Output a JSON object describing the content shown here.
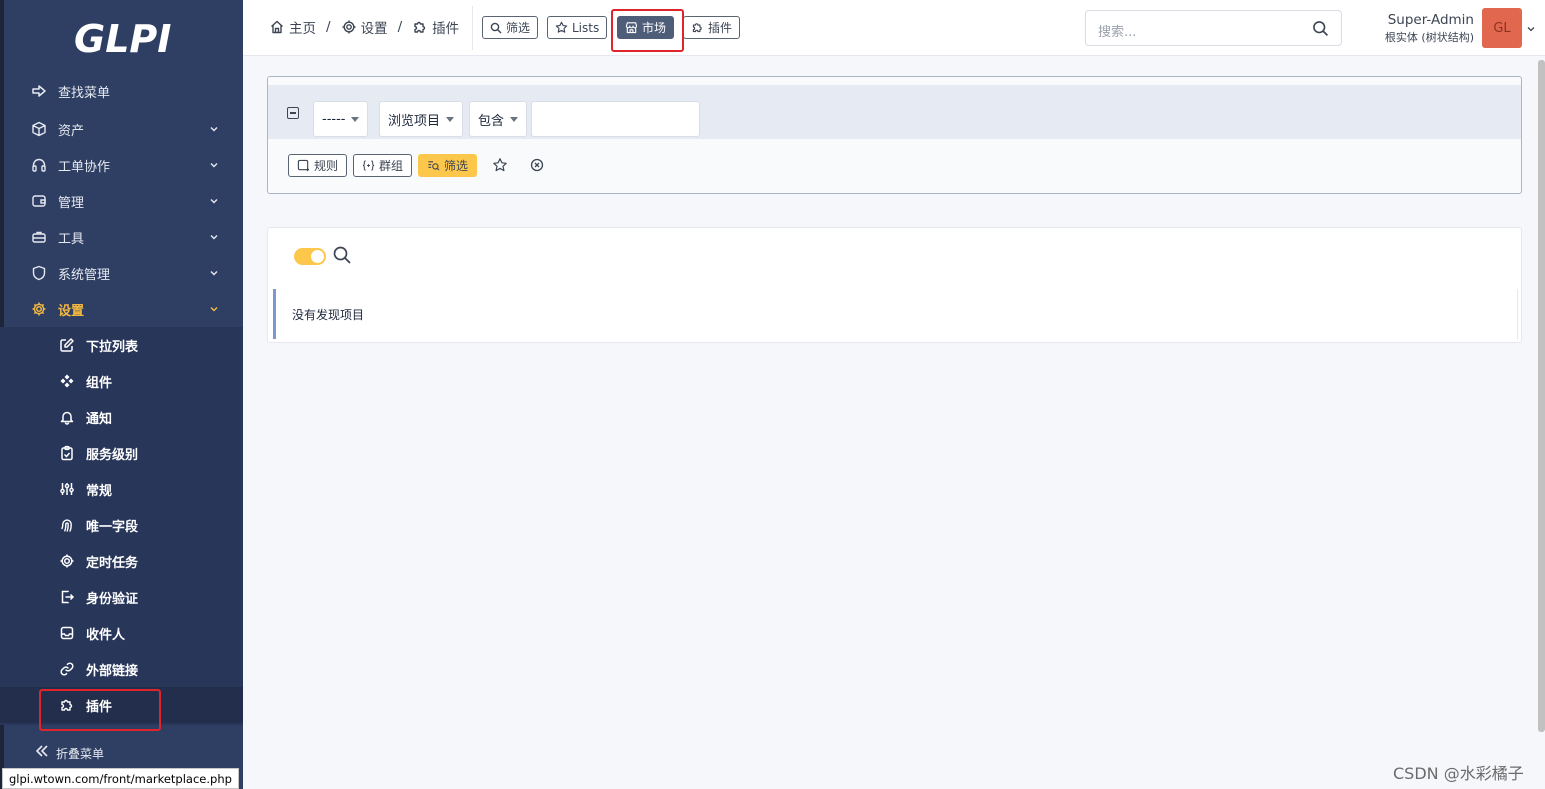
{
  "app": {
    "logo_text": "GLPI"
  },
  "sidebar": {
    "items": [
      {
        "label": "查找菜单",
        "icon": "arrow-right-icon",
        "chevron": false
      },
      {
        "label": "资产",
        "icon": "cube-icon",
        "chevron": true
      },
      {
        "label": "工单协作",
        "icon": "headset-icon",
        "chevron": true
      },
      {
        "label": "管理",
        "icon": "wallet-icon",
        "chevron": true
      },
      {
        "label": "工具",
        "icon": "briefcase-icon",
        "chevron": true
      },
      {
        "label": "系统管理",
        "icon": "shield-icon",
        "chevron": true
      },
      {
        "label": "设置",
        "icon": "gear-icon",
        "chevron": true,
        "active": true
      }
    ],
    "sub_items": [
      {
        "label": "下拉列表",
        "icon": "edit-icon"
      },
      {
        "label": "组件",
        "icon": "components-icon"
      },
      {
        "label": "通知",
        "icon": "bell-icon"
      },
      {
        "label": "服务级别",
        "icon": "clipboard-check-icon"
      },
      {
        "label": "常规",
        "icon": "adjustments-icon"
      },
      {
        "label": "唯一字段",
        "icon": "fingerprint-icon"
      },
      {
        "label": "定时任务",
        "icon": "gear-icon"
      },
      {
        "label": "身份验证",
        "icon": "login-icon"
      },
      {
        "label": "收件人",
        "icon": "inbox-icon"
      },
      {
        "label": "外部链接",
        "icon": "link-icon"
      },
      {
        "label": "插件",
        "icon": "puzzle-icon",
        "current": true
      }
    ],
    "collapse_label": "折叠菜单"
  },
  "statusbar": {
    "url": "glpi.wtown.com/front/marketplace.php"
  },
  "header": {
    "breadcrumbs": [
      {
        "label": "主页",
        "icon": "home-icon"
      },
      {
        "label": "设置",
        "icon": "gear-icon"
      },
      {
        "label": "插件",
        "icon": "puzzle-icon"
      }
    ],
    "buttons": [
      {
        "label": "筛选",
        "icon": "search-icon"
      },
      {
        "label": "Lists",
        "icon": "star-icon"
      },
      {
        "label": "市场",
        "icon": "store-icon",
        "active": true
      },
      {
        "label": "插件",
        "icon": "puzzle-icon"
      }
    ],
    "search_placeholder": "搜索...",
    "user_name": "Super-Admin",
    "entity": "根实体 (树状结构)",
    "avatar_initials": "GL"
  },
  "filter": {
    "field_select": "-----",
    "item_select": "浏览项目",
    "operator_select": "包含",
    "value": "",
    "buttons": [
      {
        "label": "规则",
        "icon": "rule-icon"
      },
      {
        "label": "群组",
        "icon": "group-icon"
      },
      {
        "label": "筛选",
        "icon": "filter-search-icon",
        "primary": true
      }
    ]
  },
  "results": {
    "empty_message": "没有发现项目"
  },
  "watermark": "CSDN @水彩橘子",
  "colors": {
    "sidebar_bg": "#2f3f64",
    "accent": "#fcc74a",
    "active_text": "#f5b940",
    "highlight": "#e0242b",
    "avatar": "#e2674f"
  }
}
